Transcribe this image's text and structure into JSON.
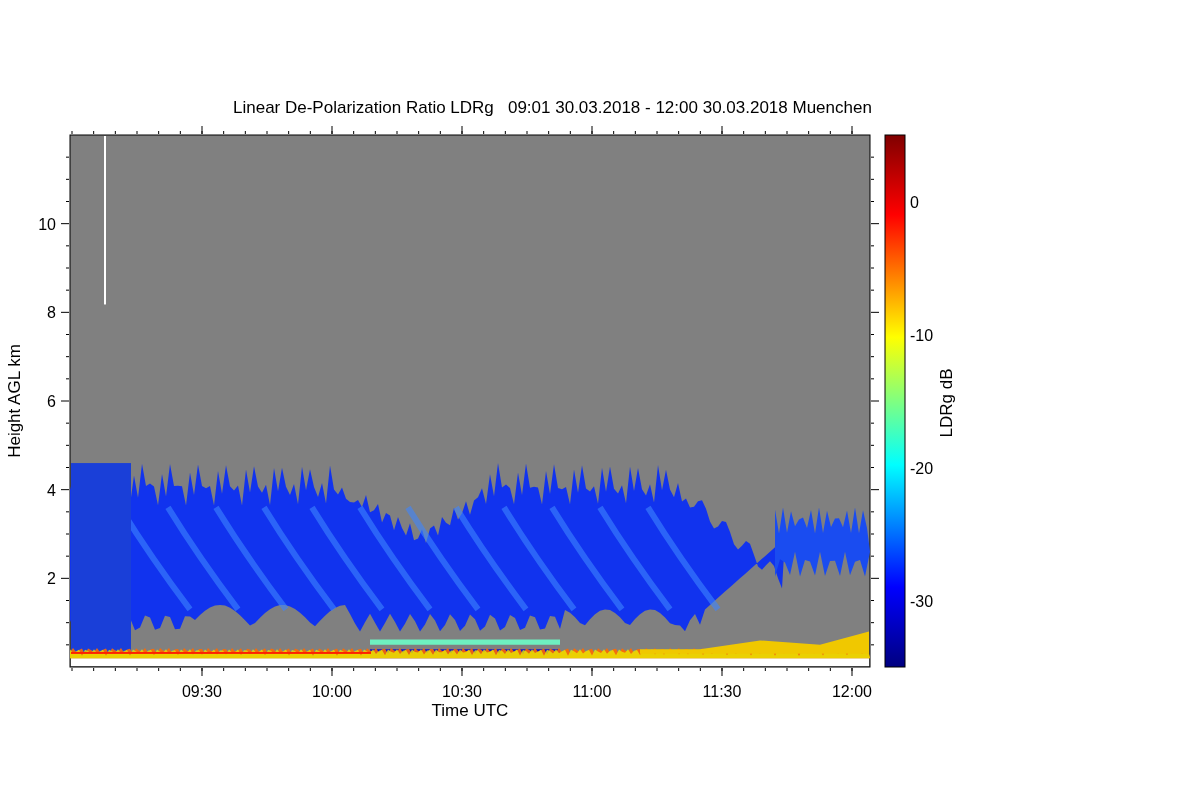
{
  "title": "Linear De-Polarization Ratio LDRg   09:01 30.03.2018 - 12:00 30.03.2018 Muenchen",
  "plot": {
    "x_axis": {
      "label": "Time UTC",
      "ticks": [
        "09:30",
        "10:00",
        "10:30",
        "11:00",
        "11:30",
        "12:00"
      ]
    },
    "y_axis": {
      "label": "Height AGL km",
      "ticks": [
        "10",
        "8",
        "6",
        "4",
        "2"
      ]
    }
  },
  "colorbar": {
    "label": "LDRg dB",
    "ticks": [
      "0",
      "-10",
      "-20",
      "-30"
    ]
  }
}
